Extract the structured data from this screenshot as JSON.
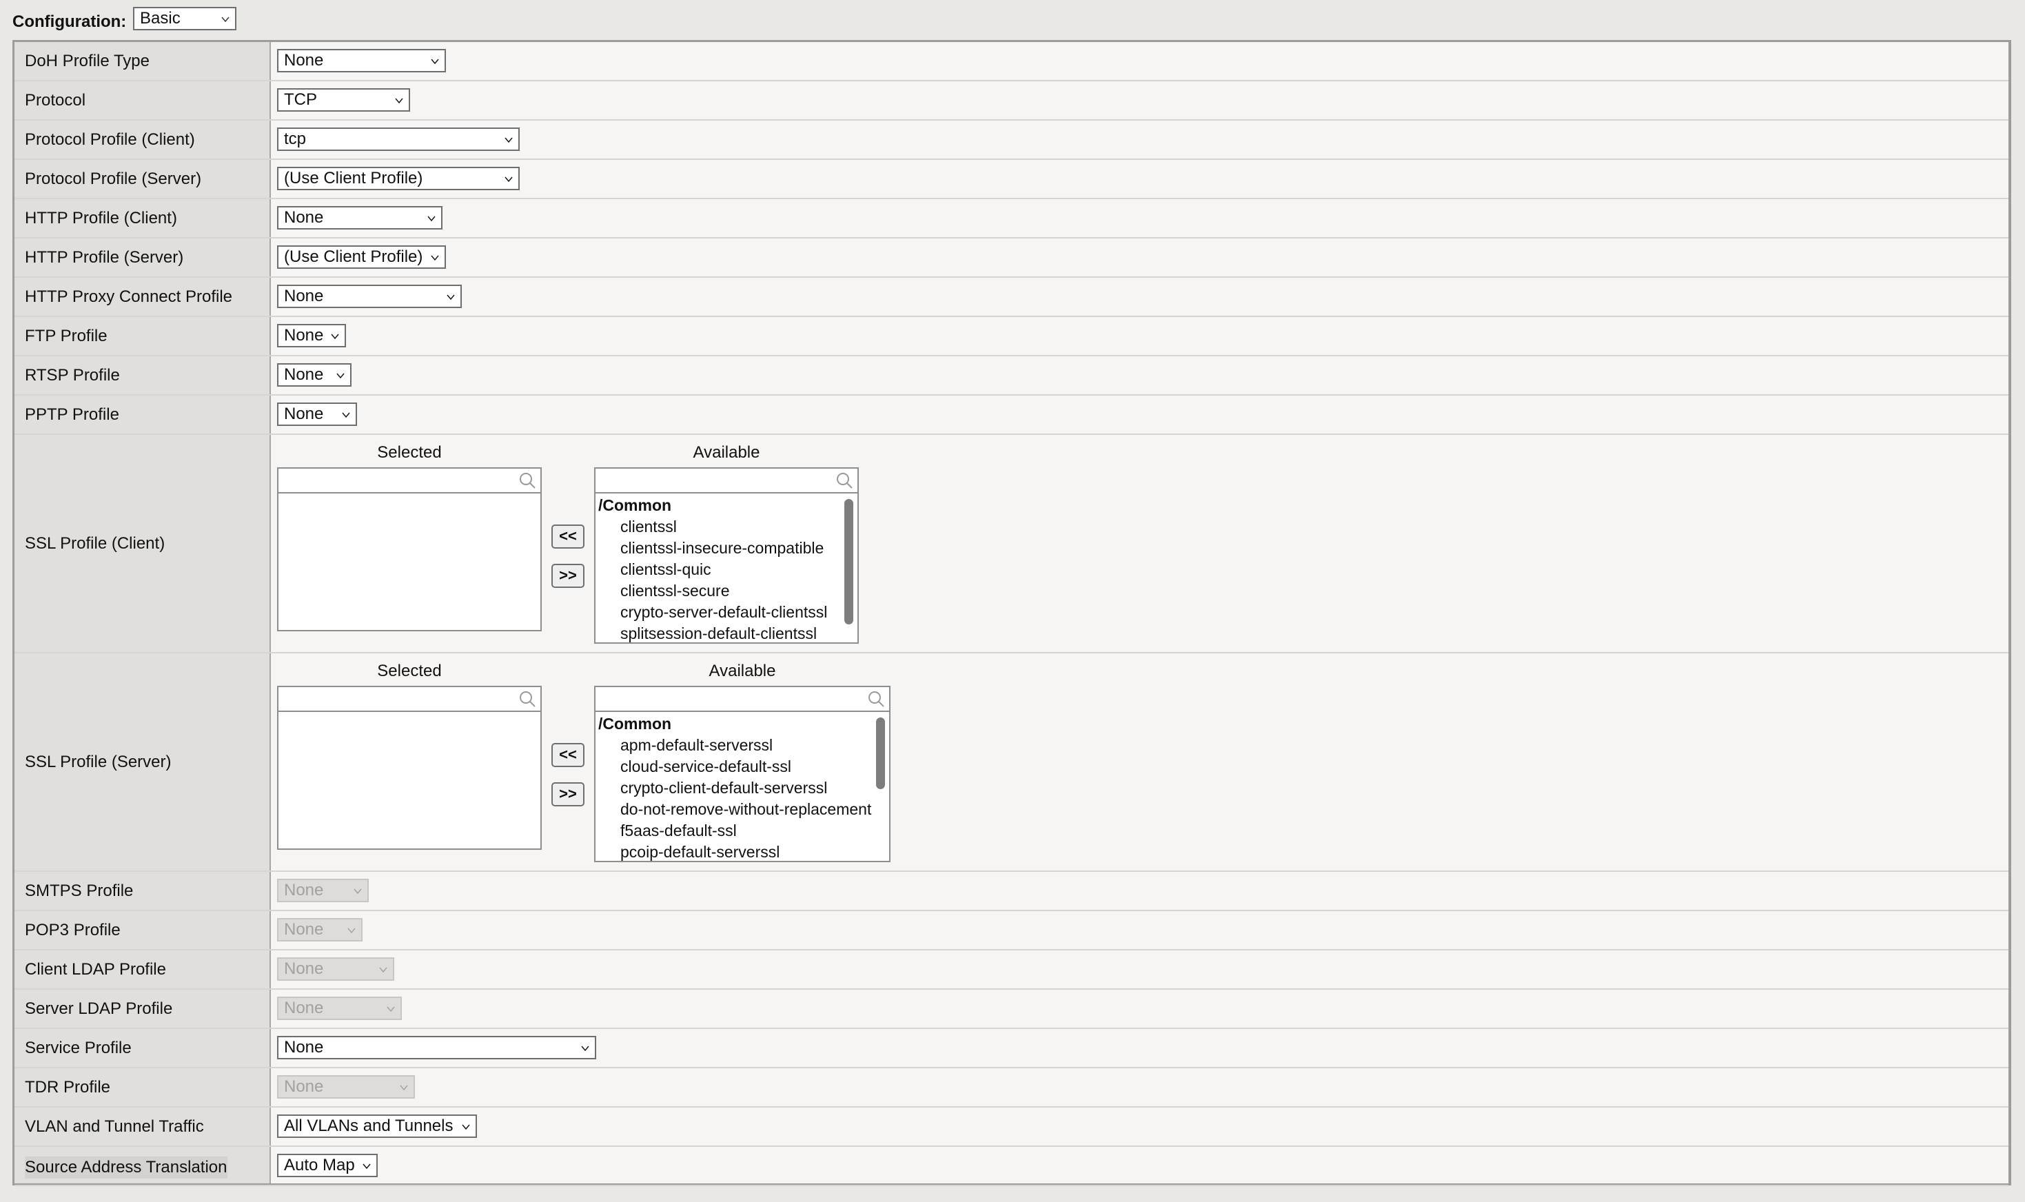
{
  "configuration": {
    "label": "Configuration:",
    "value": "Basic"
  },
  "rows": [
    {
      "label": "DoH Profile Type",
      "value": "None",
      "disabled": false
    },
    {
      "label": "Protocol",
      "value": "TCP",
      "disabled": false
    },
    {
      "label": "Protocol Profile (Client)",
      "value": "tcp",
      "disabled": false
    },
    {
      "label": "Protocol Profile (Server)",
      "value": "(Use Client Profile)",
      "disabled": false
    },
    {
      "label": "HTTP Profile (Client)",
      "value": "None",
      "disabled": false
    },
    {
      "label": "HTTP Profile (Server)",
      "value": "(Use Client Profile)",
      "disabled": false
    },
    {
      "label": "HTTP Proxy Connect Profile",
      "value": "None",
      "disabled": false
    },
    {
      "label": "FTP Profile",
      "value": "None",
      "disabled": false
    },
    {
      "label": "RTSP Profile",
      "value": "None",
      "disabled": false
    },
    {
      "label": "PPTP Profile",
      "value": "None",
      "disabled": false
    },
    {
      "label": "SMTPS Profile",
      "value": "None",
      "disabled": true
    },
    {
      "label": "POP3 Profile",
      "value": "None",
      "disabled": true
    },
    {
      "label": "Client LDAP Profile",
      "value": "None",
      "disabled": true
    },
    {
      "label": "Server LDAP Profile",
      "value": "None",
      "disabled": true
    },
    {
      "label": "Service Profile",
      "value": "None",
      "disabled": false
    },
    {
      "label": "TDR Profile",
      "value": "None",
      "disabled": true
    },
    {
      "label": "VLAN and Tunnel Traffic",
      "value": "All VLANs and Tunnels",
      "disabled": false
    },
    {
      "label": "Source Address Translation",
      "value": "Auto Map",
      "disabled": false
    }
  ],
  "ssl_client": {
    "label": "SSL Profile (Client)",
    "selected_title": "Selected",
    "available_title": "Available",
    "selected_items": [],
    "available_group": "/Common",
    "available_items": [
      "clientssl",
      "clientssl-insecure-compatible",
      "clientssl-quic",
      "clientssl-secure",
      "crypto-server-default-clientssl",
      "splitsession-default-clientssl"
    ],
    "move_left": "<<",
    "move_right": ">>"
  },
  "ssl_server": {
    "label": "SSL Profile (Server)",
    "selected_title": "Selected",
    "available_title": "Available",
    "selected_items": [],
    "available_group": "/Common",
    "available_items": [
      "apm-default-serverssl",
      "cloud-service-default-ssl",
      "crypto-client-default-serverssl",
      "do-not-remove-without-replacement",
      "f5aas-default-ssl",
      "pcoip-default-serverssl"
    ],
    "move_left": "<<",
    "move_right": ">>"
  }
}
